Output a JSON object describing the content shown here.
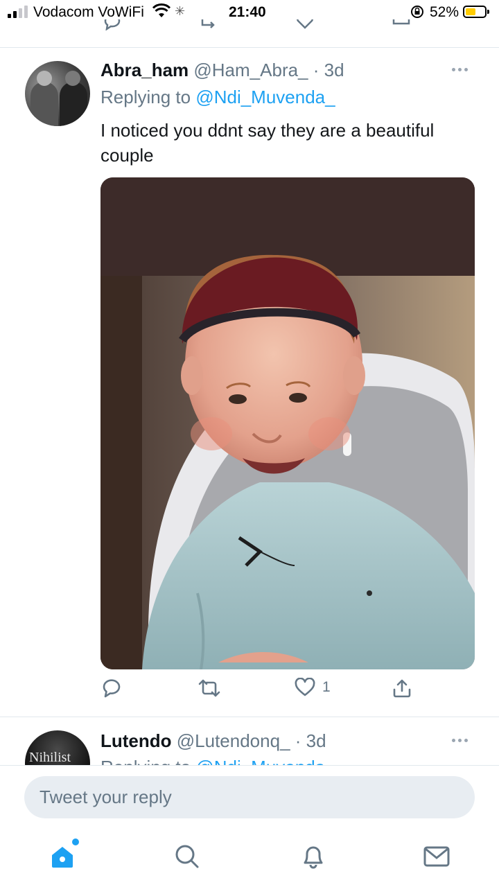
{
  "status_bar": {
    "carrier": "Vodacom VoWiFi",
    "time": "21:40",
    "battery_percent": "52%"
  },
  "tweet": {
    "display_name": "Abra_ham",
    "handle_time": "@Ham_Abra_ · 3d",
    "replying_to_prefix": "Replying to",
    "replying_to_handle": "@Ndi_Muvenda_",
    "text": "I noticed you ddnt say they are a beautiful couple",
    "like_count": "1"
  },
  "next_tweet": {
    "display_name": "Lutendo",
    "handle_time": "@Lutendonq_ · 3d",
    "replying_to_prefix": "Replying to",
    "replying_to_handle": "@Ndi_Muvenda_",
    "avatar_text": "Nihilist"
  },
  "reply_box": {
    "placeholder": "Tweet your reply"
  },
  "tab_bar": {
    "tabs": [
      "home-icon",
      "search-icon",
      "notifications-bell-icon",
      "messages-mail-icon"
    ],
    "active": "home-icon"
  },
  "colors": {
    "accent": "#1da1f2",
    "secondary_text": "#657786",
    "primary_text": "#0f1419"
  }
}
